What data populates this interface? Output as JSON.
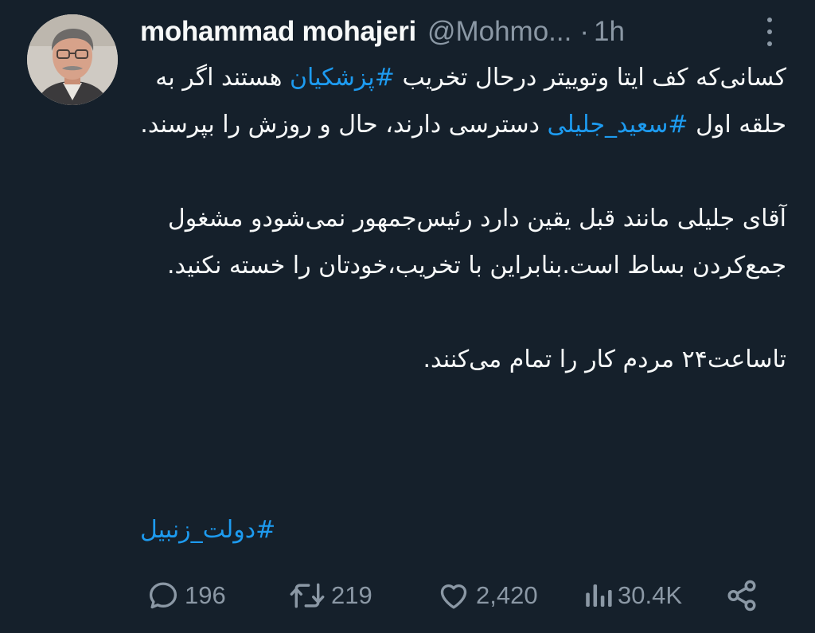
{
  "author": {
    "display_name": "mohammad mohajeri",
    "handle": "@Mohmo...",
    "separator": "·",
    "time": "1h"
  },
  "tweet": {
    "p1": {
      "t1": "کسانی‌که کف ایتا وتوییتر درحال تخریب ",
      "tag1": "#پزشکیان",
      "t2": " هستند اگر به حلقه اول ",
      "tag2": "#سعید_جلیلی",
      "t3": " دسترسی دارند، حال و روزش را بپرسند."
    },
    "p2": "آقای جلیلی مانند قبل یقین دارد رئیس‌جمهور نمی‌شودو مشغول جمع‌کردن بساط است.بنابراین با تخریب،خودتان را خسته نکنید.",
    "p3": "تاساعت۲۴ مردم کار را تمام می‌کنند.",
    "footer_hashtag": "#دولت_زنبیل"
  },
  "actions": {
    "replies": "196",
    "retweets": "219",
    "likes": "2,420",
    "views": "30.4K"
  },
  "icons": {
    "reply": "reply-icon",
    "retweet": "retweet-icon",
    "like": "heart-icon",
    "views": "views-icon",
    "share": "share-icon",
    "more": "more-vertical-icon"
  },
  "colors": {
    "background": "#15202b",
    "text": "#f7f9f9",
    "muted": "#8b98a5",
    "link": "#1d9bf0"
  }
}
